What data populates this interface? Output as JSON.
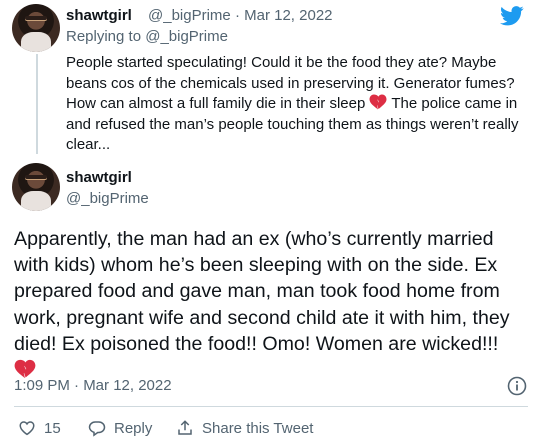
{
  "reply_tweet": {
    "name": "shawtgirl",
    "handle": "@_bigPrime",
    "separator": "·",
    "date": "Mar 12, 2022",
    "replying_to_label": "Replying to",
    "replying_to_handle": "@_bigPrime",
    "text_part1": "People started speculating! Could it be the food they ate? Maybe beans cos of the chemicals used in preserving it. Generator fumes? How can almost a full family die in their sleep",
    "text_part2": " The police came in and refused the man’s people touching them as things weren’t really clear..."
  },
  "main_tweet": {
    "name": "shawtgirl",
    "handle": "@_bigPrime",
    "text": "Apparently, the man had an ex (who’s currently married with kids) whom he’s been sleeping with on the side. Ex prepared food and gave man, man took food home from work, pregnant wife and second child ate it with him, they died! Ex poisoned the food!! Omo! Women are wicked!!!",
    "timestamp": "1:09 PM · Mar 12, 2022"
  },
  "actions": {
    "like_count": "15",
    "reply_label": "Reply",
    "share_label": "Share this Tweet"
  },
  "icons": {
    "brand": "twitter-bird-icon",
    "emoji": "broken-heart-icon",
    "info": "info-icon",
    "like": "heart-outline-icon",
    "reply": "speech-bubble-icon",
    "share": "share-upload-icon"
  },
  "colors": {
    "brand_blue": "#1d9bf0",
    "text_primary": "#0f1419",
    "text_secondary": "#536471",
    "broken_heart": "#dd2e44",
    "divider": "#cfd9de"
  }
}
